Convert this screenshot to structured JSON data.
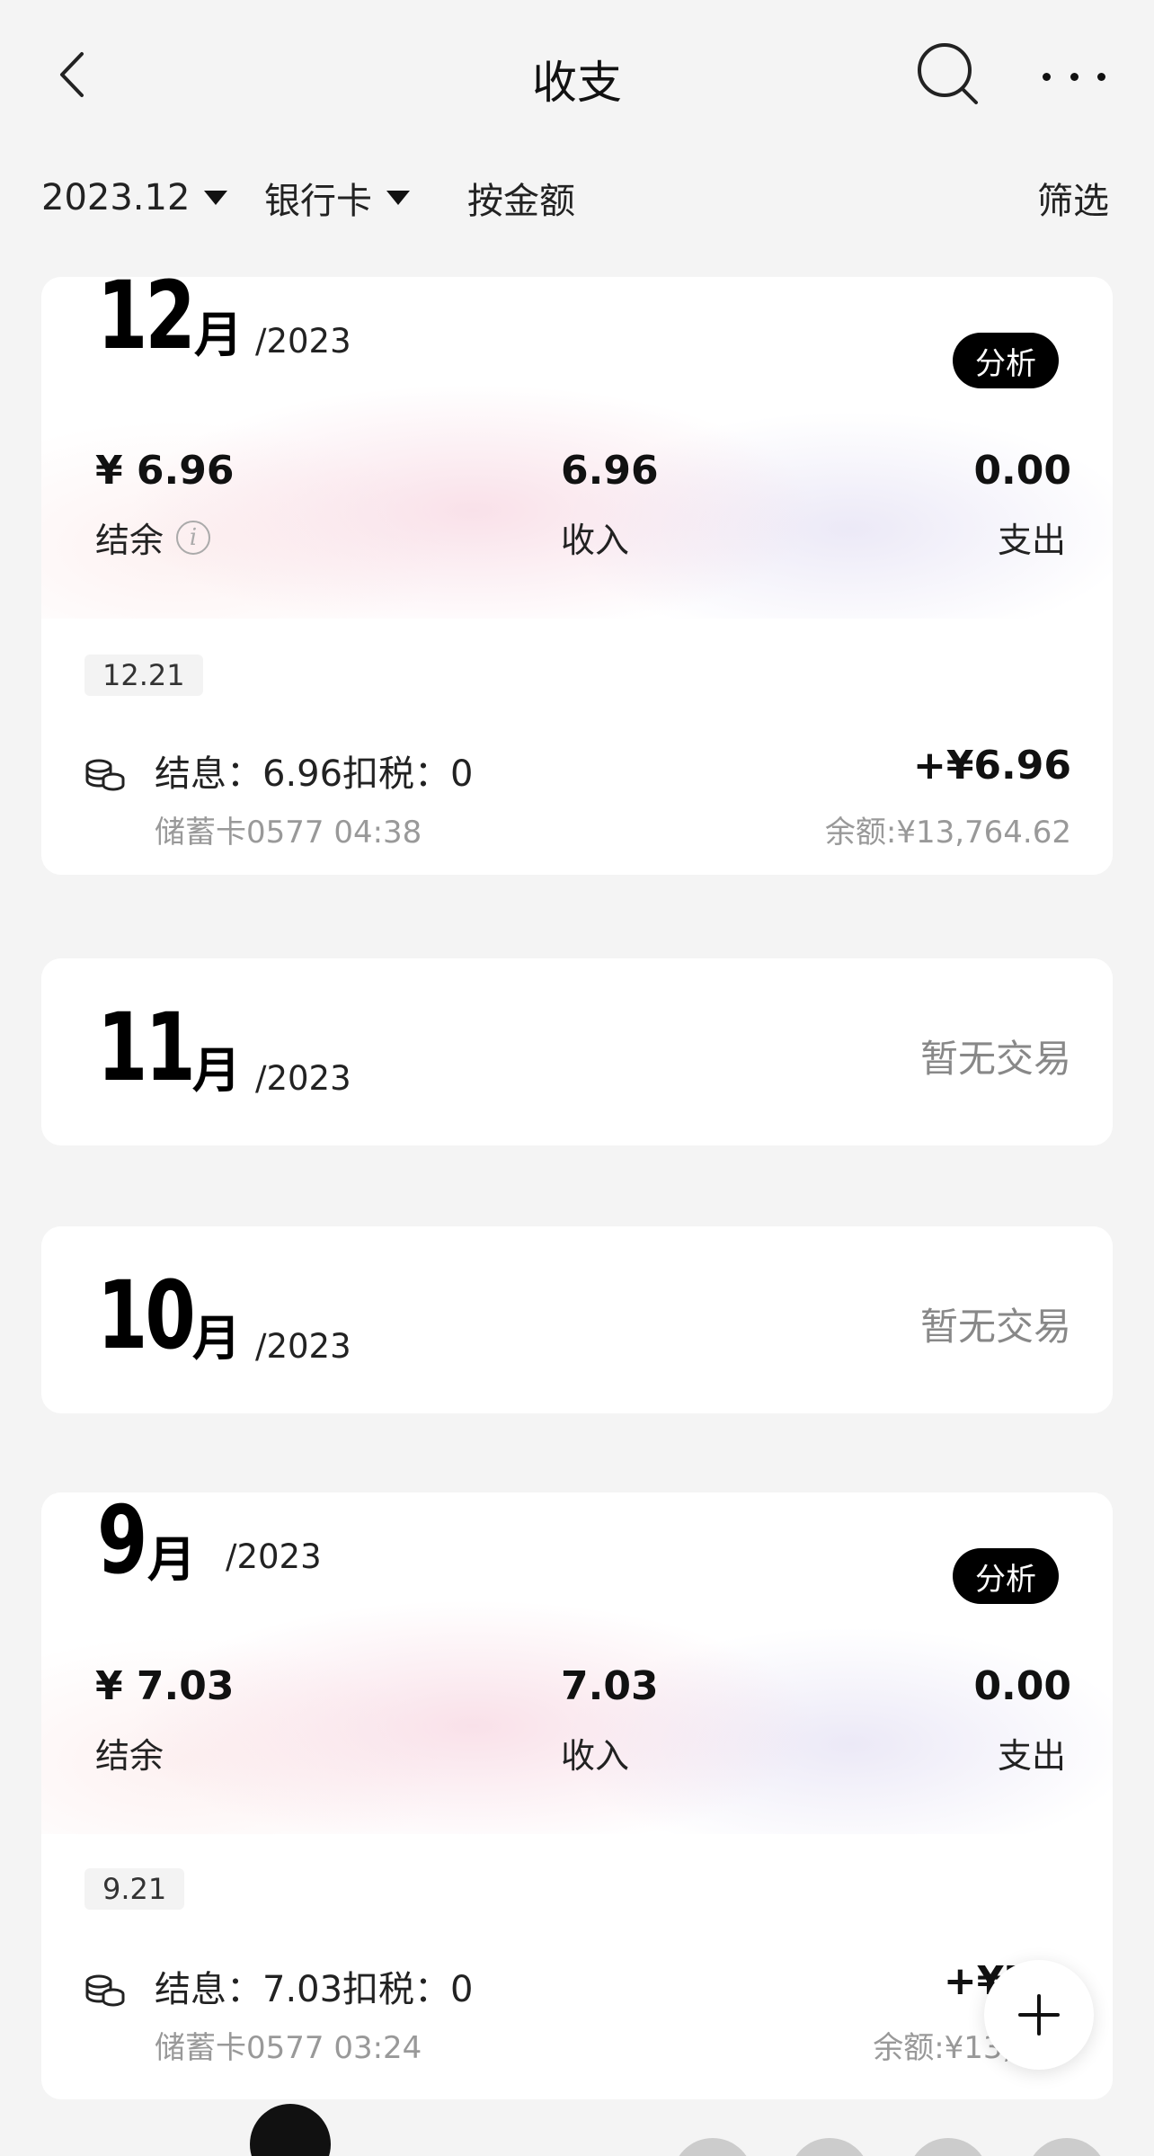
{
  "header": {
    "title": "收支",
    "back_icon": "chevron-left-icon",
    "search_icon": "search-icon",
    "more_icon": "more-icon"
  },
  "filters": {
    "month": "2023.12",
    "card_type": "银行卡",
    "sort": "按金额",
    "filter": "筛选"
  },
  "months": [
    {
      "month_num": "12",
      "month_char": "月",
      "year": "/2023",
      "analyze_label": "分析",
      "balance_value": "¥ 6.96",
      "balance_label": "结余",
      "income_value": "6.96",
      "income_label": "收入",
      "expense_value": "0.00",
      "expense_label": "支出",
      "transactions": [
        {
          "date": "12.21",
          "title": "结息：6.96扣税：0",
          "amount": "+¥6.96",
          "sub": "储蓄卡0577 04:38",
          "balance": "余额:¥13,764.62"
        }
      ]
    },
    {
      "month_num": "11",
      "month_char": "月",
      "year": "/2023",
      "empty_text": "暂无交易"
    },
    {
      "month_num": "10",
      "month_char": "月",
      "year": "/2023",
      "empty_text": "暂无交易"
    },
    {
      "month_num": "9",
      "month_char": "月",
      "year": "/2023",
      "analyze_label": "分析",
      "balance_value": "¥ 7.03",
      "balance_label": "结余",
      "income_value": "7.03",
      "income_label": "收入",
      "expense_value": "0.00",
      "expense_label": "支出",
      "transactions": [
        {
          "date": "9.21",
          "title": "结息：7.03扣税：0",
          "amount": "+¥7",
          "sub": "储蓄卡0577 03:24",
          "balance": "余额:¥13,7"
        }
      ]
    }
  ],
  "fab": {
    "icon": "plus-icon"
  },
  "colors": {
    "accent": "#000000",
    "muted": "#999999",
    "background": "#f4f4f4"
  }
}
